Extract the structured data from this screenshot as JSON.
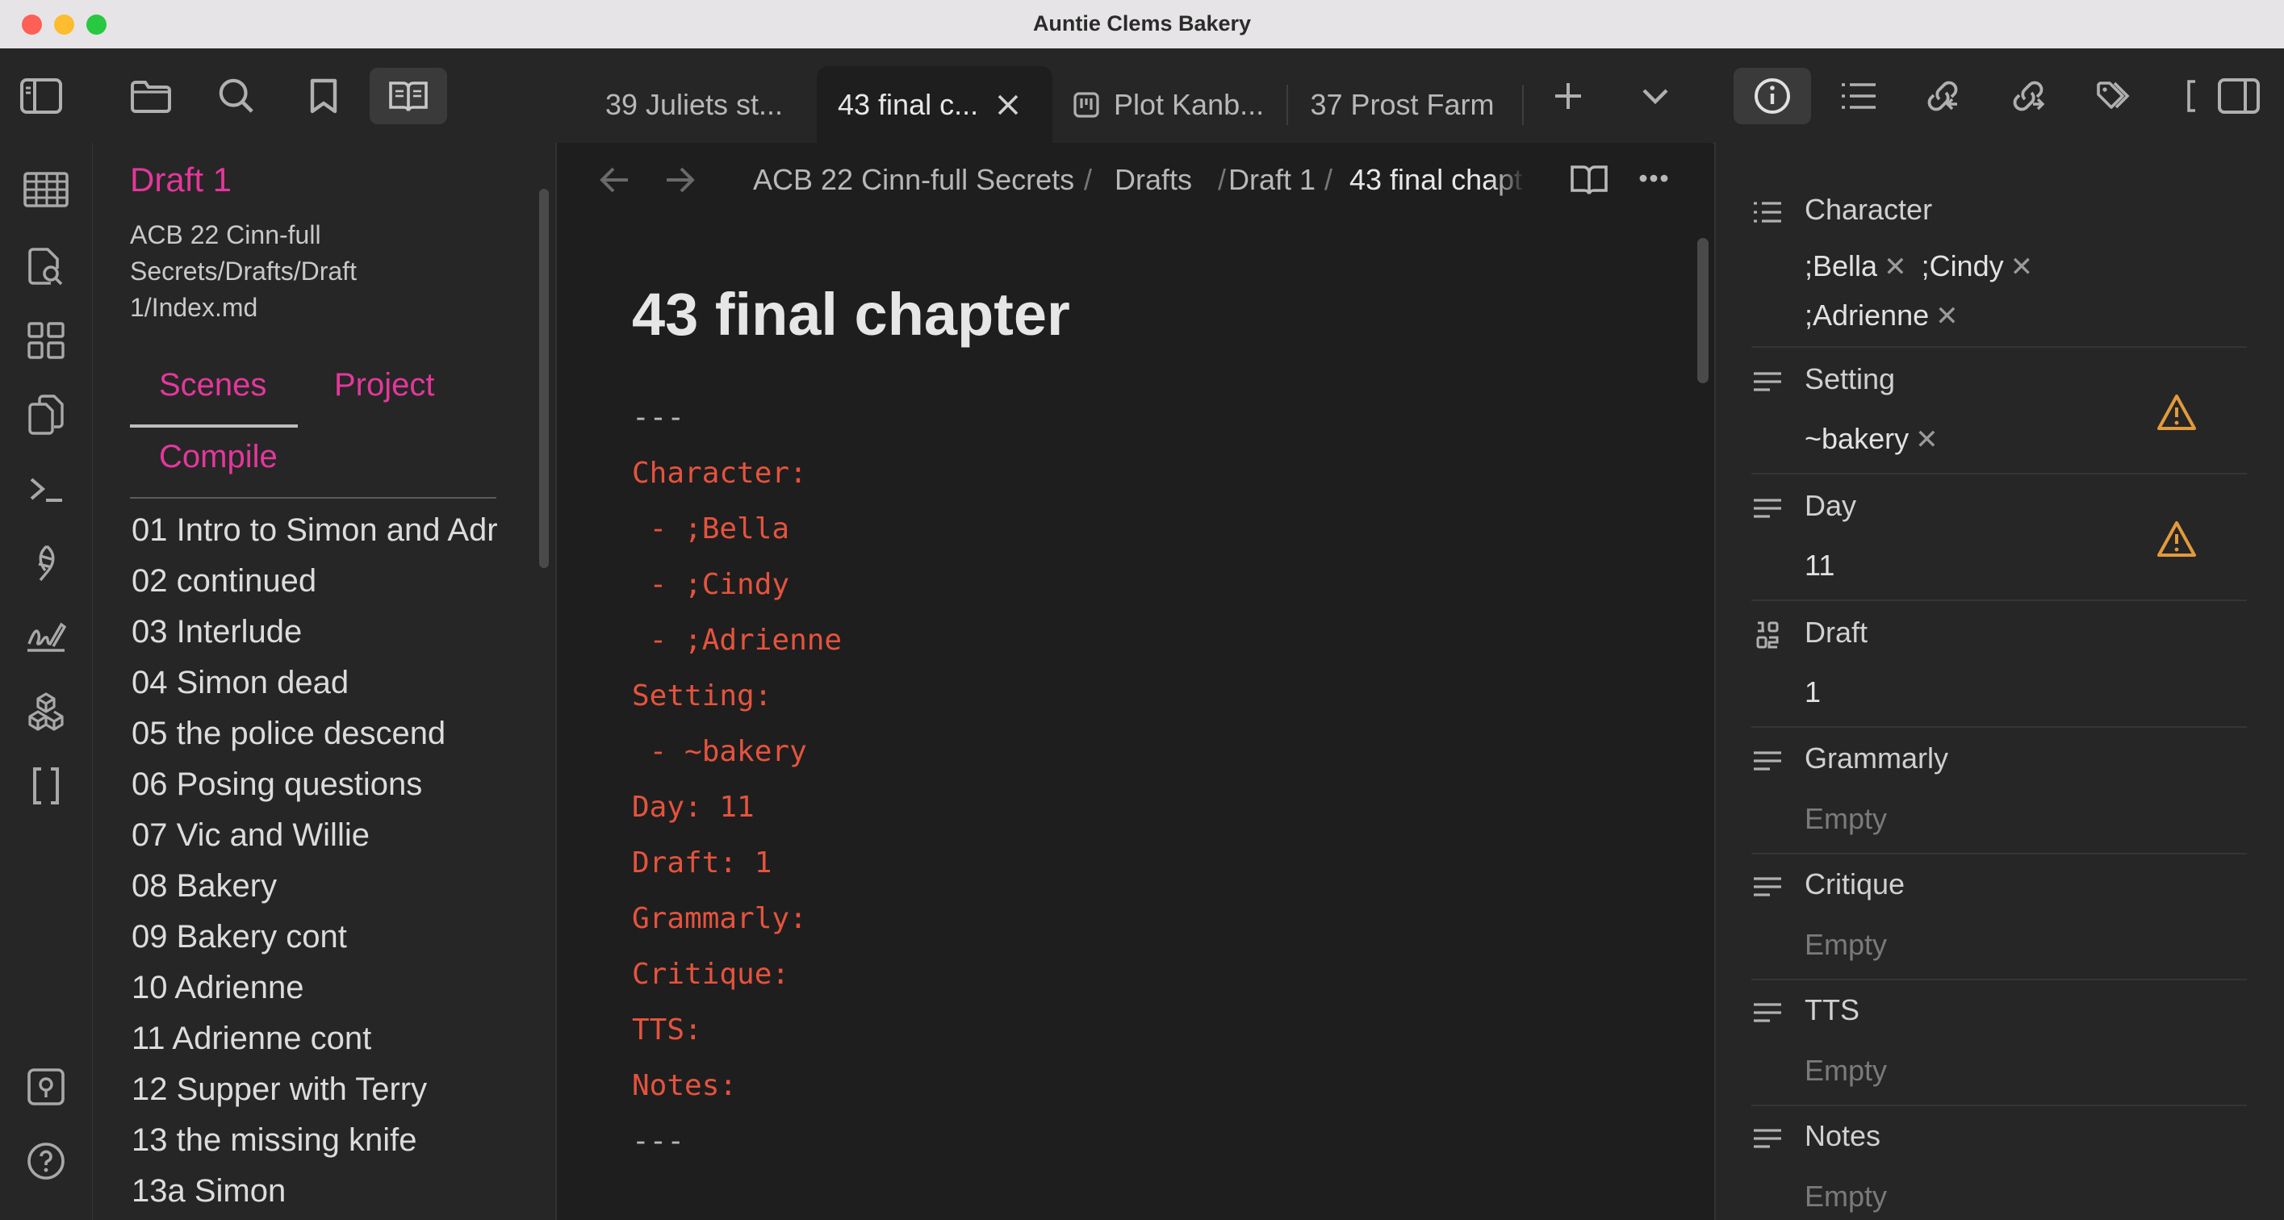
{
  "window": {
    "title": "Auntie Clems Bakery"
  },
  "tabs": [
    {
      "label": "39 Juliets st..."
    },
    {
      "label": "43 final c..."
    },
    {
      "label": "Plot Kanb..."
    },
    {
      "label": "37 Prost Farm"
    }
  ],
  "sidebar": {
    "draft_title": "Draft 1",
    "path": "ACB 22 Cinn-full Secrets/Drafts/Draft 1/Index.md",
    "tabs": [
      "Scenes",
      "Project",
      "Compile"
    ],
    "scenes": [
      "01 Intro to Simon and Adr",
      "02 continued",
      "03 Interlude",
      "04 Simon dead",
      "05 the police descend",
      "06 Posing questions",
      "07 Vic and Willie",
      "08 Bakery",
      "09 Bakery cont",
      "10 Adrienne",
      "11 Adrienne cont",
      "12 Supper with Terry",
      "13 the missing knife",
      "13a Simon"
    ]
  },
  "breadcrumb": [
    "ACB 22 Cinn-full Secrets",
    "Drafts",
    "Draft 1",
    "43 final chapt"
  ],
  "breadcrumb_sep": "/",
  "document": {
    "title": "43 final chapter",
    "frontmatter": [
      "---",
      "Character:",
      " - ;Bella",
      " - ;Cindy",
      " - ;Adrienne",
      "Setting:",
      " - ~bakery",
      "Day: 11",
      "Draft: 1",
      "Grammarly:",
      "Critique:",
      "TTS:",
      "Notes:",
      "---"
    ]
  },
  "properties": {
    "character": {
      "label": "Character",
      "values": [
        ";Bella",
        ";Cindy",
        ";Adrienne"
      ]
    },
    "setting": {
      "label": "Setting",
      "values": [
        "~bakery"
      ]
    },
    "day": {
      "label": "Day",
      "value": "11"
    },
    "draft": {
      "label": "Draft",
      "value": "1"
    },
    "grammarly": {
      "label": "Grammarly",
      "empty": "Empty"
    },
    "critique": {
      "label": "Critique",
      "empty": "Empty"
    },
    "tts": {
      "label": "TTS",
      "empty": "Empty"
    },
    "notes": {
      "label": "Notes",
      "empty": "Empty"
    }
  },
  "colors": {
    "accent": "#e4379b",
    "frontmatter": "#e5533d",
    "warning": "#e39a3c"
  },
  "icons": {
    "toolbar": [
      "sidebar-toggle-icon",
      "folder-icon",
      "search-icon",
      "bookmark-icon",
      "reading-view-icon",
      "plus-icon",
      "chevron-down-icon",
      "info-icon",
      "outline-icon",
      "backlinks-icon",
      "outgoing-links-icon",
      "tags-icon",
      "right-sidebar-icon"
    ],
    "ribbon": [
      "table-icon",
      "file-search-icon",
      "dashboard-icon",
      "copy-icon",
      "terminal-icon",
      "feather-icon",
      "signature-icon",
      "cubes-icon",
      "brackets-icon",
      "vault-icon",
      "help-icon"
    ]
  }
}
